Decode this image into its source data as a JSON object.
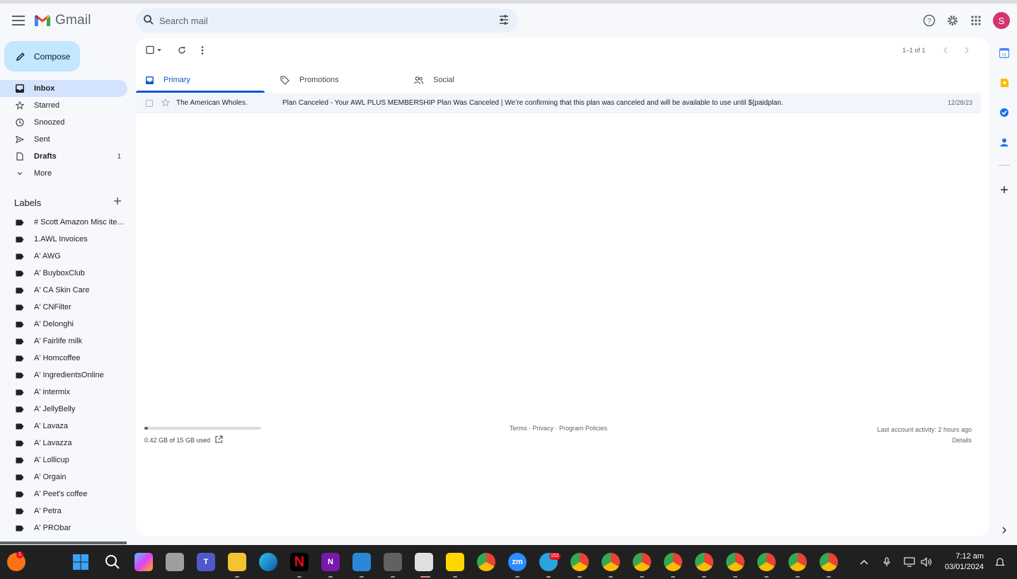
{
  "app": {
    "name": "Gmail",
    "brand_color": "#c5221f"
  },
  "search": {
    "placeholder": "Search mail"
  },
  "header": {
    "avatar_initial": "S",
    "avatar_color": "#d6336c"
  },
  "compose": {
    "label": "Compose"
  },
  "nav": {
    "items": [
      {
        "label": "Inbox",
        "icon": "inbox-icon",
        "active": true
      },
      {
        "label": "Starred",
        "icon": "star-icon"
      },
      {
        "label": "Snoozed",
        "icon": "clock-icon"
      },
      {
        "label": "Sent",
        "icon": "send-icon"
      },
      {
        "label": "Drafts",
        "icon": "draft-icon",
        "count": "1"
      },
      {
        "label": "More",
        "icon": "chevron-down-icon"
      }
    ]
  },
  "labels": {
    "title": "Labels",
    "items": [
      "# Scott Amazon Misc ite...",
      "1.AWL Invoices",
      "A' AWG",
      "A' BuyboxClub",
      "A' CA Skin Care",
      "A' CNFilter",
      "A' Delonghi",
      "A' Fairlife milk",
      "A' Homcoffee",
      "A' IngredientsOnline",
      "A' intermix",
      "A' JellyBelly",
      "A' Lavaza",
      "A' Lavazza",
      "A' Lollicup",
      "A' Orgain",
      "A' Peet's coffee",
      "A' Petra",
      "A' PRObar"
    ]
  },
  "toolbar": {
    "pager": "1–1 of 1"
  },
  "tabs": [
    {
      "label": "Primary",
      "icon": "inbox-tab-icon",
      "active": true
    },
    {
      "label": "Promotions",
      "icon": "tag-icon"
    },
    {
      "label": "Social",
      "icon": "people-icon"
    }
  ],
  "mail": [
    {
      "sender": "The American Wholes.",
      "subject": "Plan Canceled - Your AWL PLUS MEMBERSHIP Plan Was Canceled | We’re confirming that this plan was canceled and will be available to use until ${paidplan.",
      "date": "12/28/23"
    }
  ],
  "footer": {
    "storage": "0.42 GB of 15 GB used",
    "storage_fraction": 0.028,
    "links": "Terms · Privacy · Program Policies",
    "activity": "Last account activity: 2 hours ago",
    "details": "Details"
  },
  "taskbar": {
    "time": "7:12 am",
    "date": "03/01/2024",
    "telegram_badge": "152",
    "app_badge": "1"
  }
}
